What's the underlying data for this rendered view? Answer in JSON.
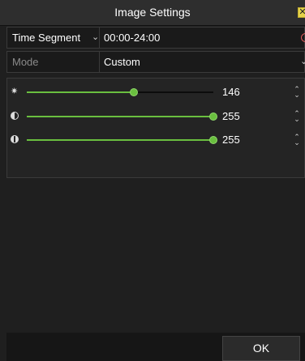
{
  "window": {
    "title": "Image Settings",
    "close_label": "✕"
  },
  "time_segment": {
    "label": "Time Segment",
    "value": "00:00-24:00"
  },
  "mode": {
    "label": "Mode",
    "value": "Custom"
  },
  "sliders": [
    {
      "name": "brightness",
      "icon": "brightness-icon",
      "value": "146",
      "level": 146,
      "max": 255
    },
    {
      "name": "contrast",
      "icon": "contrast-icon",
      "value": "255",
      "level": 255,
      "max": 255
    },
    {
      "name": "saturation",
      "icon": "saturation-icon",
      "value": "255",
      "level": 255,
      "max": 255
    }
  ],
  "footer": {
    "ok_label": "OK"
  },
  "colors": {
    "accent": "#6abf3f",
    "close_button": "#e5d24a",
    "clock_icon": "#e25b5b"
  }
}
